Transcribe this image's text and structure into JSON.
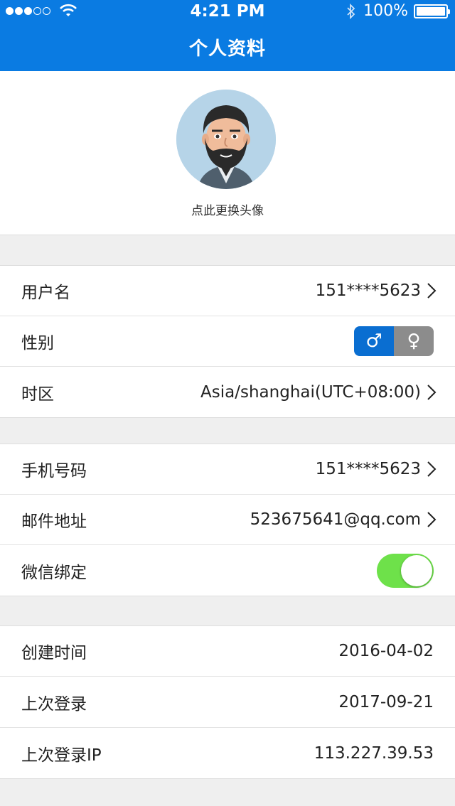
{
  "status_bar": {
    "time": "4:21 PM",
    "battery": "100%",
    "signal_icon": "signal-dots-icon",
    "wifi_icon": "wifi-icon",
    "bluetooth_icon": "bluetooth-icon",
    "battery_icon": "battery-icon"
  },
  "header": {
    "title": "个人资料",
    "color": "#0a7be2"
  },
  "avatar": {
    "caption": "点此更换头像",
    "icon": "avatar-illustration"
  },
  "group1": {
    "username": {
      "label": "用户名",
      "value": "151****5623"
    },
    "gender": {
      "label": "性别",
      "male_symbol": "♂",
      "female_symbol": "♀",
      "selected": "male"
    },
    "timezone": {
      "label": "时区",
      "value": "Asia/shanghai(UTC+08:00)"
    }
  },
  "group2": {
    "phone": {
      "label": "手机号码",
      "value": "151****5623"
    },
    "email": {
      "label": "邮件地址",
      "value": "523675641@qq.com"
    },
    "wechat": {
      "label": "微信绑定",
      "enabled": true
    }
  },
  "group3": {
    "created": {
      "label": "创建时间",
      "value": "2016-04-02"
    },
    "last_login": {
      "label": "上次登录",
      "value": "2017-09-21"
    },
    "last_login_ip": {
      "label": "上次登录IP",
      "value": "113.227.39.53"
    }
  },
  "colors": {
    "accent": "#0a7be2",
    "toggle_on": "#6ee14a",
    "background": "#efefef"
  }
}
